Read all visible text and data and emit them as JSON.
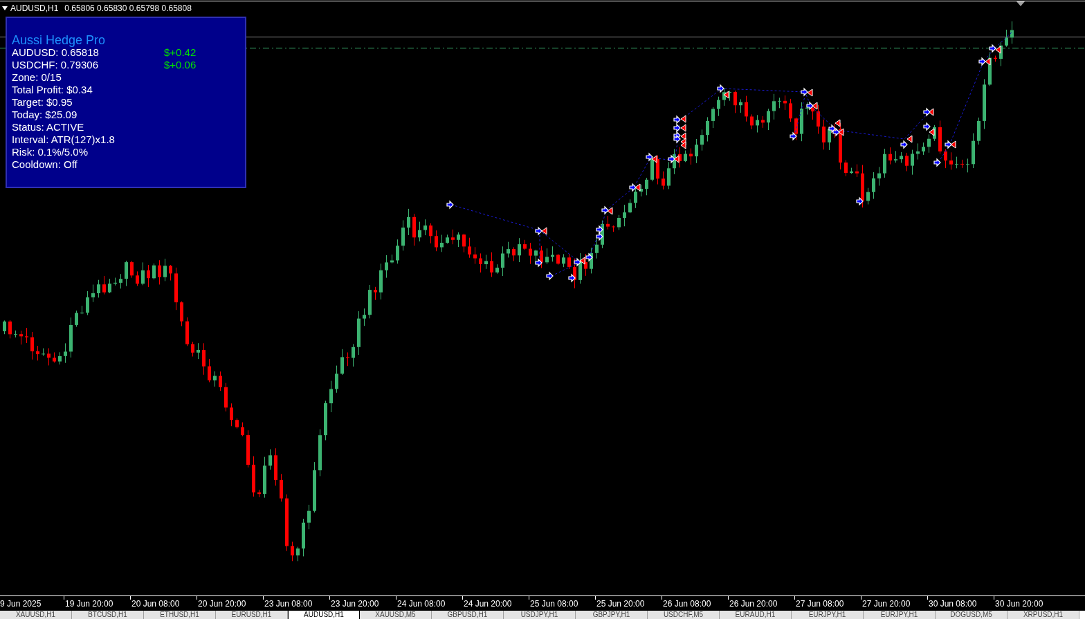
{
  "chart_header": {
    "symbol": "AUDUSD,H1",
    "prices": "0.65806 0.65830 0.65798 0.65808"
  },
  "info_panel": {
    "title": "Aussi Hedge Pro",
    "lines": [
      {
        "text": "AUDUSD: 0.65818",
        "profit": "$+0.42"
      },
      {
        "text": "USDCHF: 0.79306",
        "profit": "$+0.06"
      },
      {
        "text": "Zone: 0/15"
      },
      {
        "text": "Total Profit: $0.34"
      },
      {
        "text": "Target: $0.95"
      },
      {
        "text": "Today: $25.09"
      },
      {
        "text": "Status: ACTIVE"
      },
      {
        "text": "Interval: ATR(127)x1.8"
      },
      {
        "text": "Risk: 0.1%/5.0%"
      },
      {
        "text": "Cooldown: Off"
      }
    ]
  },
  "time_axis": {
    "labels": [
      "9 Jun 2025",
      "19 Jun 20:00",
      "20 Jun 08:00",
      "20 Jun 20:00",
      "23 Jun 08:00",
      "23 Jun 20:00",
      "24 Jun 08:00",
      "24 Jun 20:00",
      "25 Jun 08:00",
      "25 Jun 20:00",
      "26 Jun 08:00",
      "26 Jun 20:00",
      "27 Jun 08:00",
      "27 Jun 20:00",
      "30 Jun 08:00",
      "30 Jun 20:00"
    ]
  },
  "chart_tabs": [
    {
      "label": "XAUUSD,H1",
      "selected": false
    },
    {
      "label": "BTCUSD,H1",
      "selected": false
    },
    {
      "label": "ETHUSD,H1",
      "selected": false
    },
    {
      "label": "EURUSD,H1",
      "selected": false
    },
    {
      "label": "AUDUSD,H1",
      "selected": true
    },
    {
      "label": "XAUUSD,M5",
      "selected": false
    },
    {
      "label": "GBPUSD,H1",
      "selected": false
    },
    {
      "label": "USDJPY,H1",
      "selected": false
    },
    {
      "label": "GBPJPY,H1",
      "selected": false
    },
    {
      "label": "USDCHF,M5",
      "selected": false
    },
    {
      "label": "EURAUD,H1",
      "selected": false
    },
    {
      "label": "EURJPY,H1",
      "selected": false
    },
    {
      "label": "EURJPY,H1",
      "selected": false
    },
    {
      "label": "DOGUSD,M5",
      "selected": false
    },
    {
      "label": "XRPUSD,H1",
      "selected": false
    }
  ]
}
